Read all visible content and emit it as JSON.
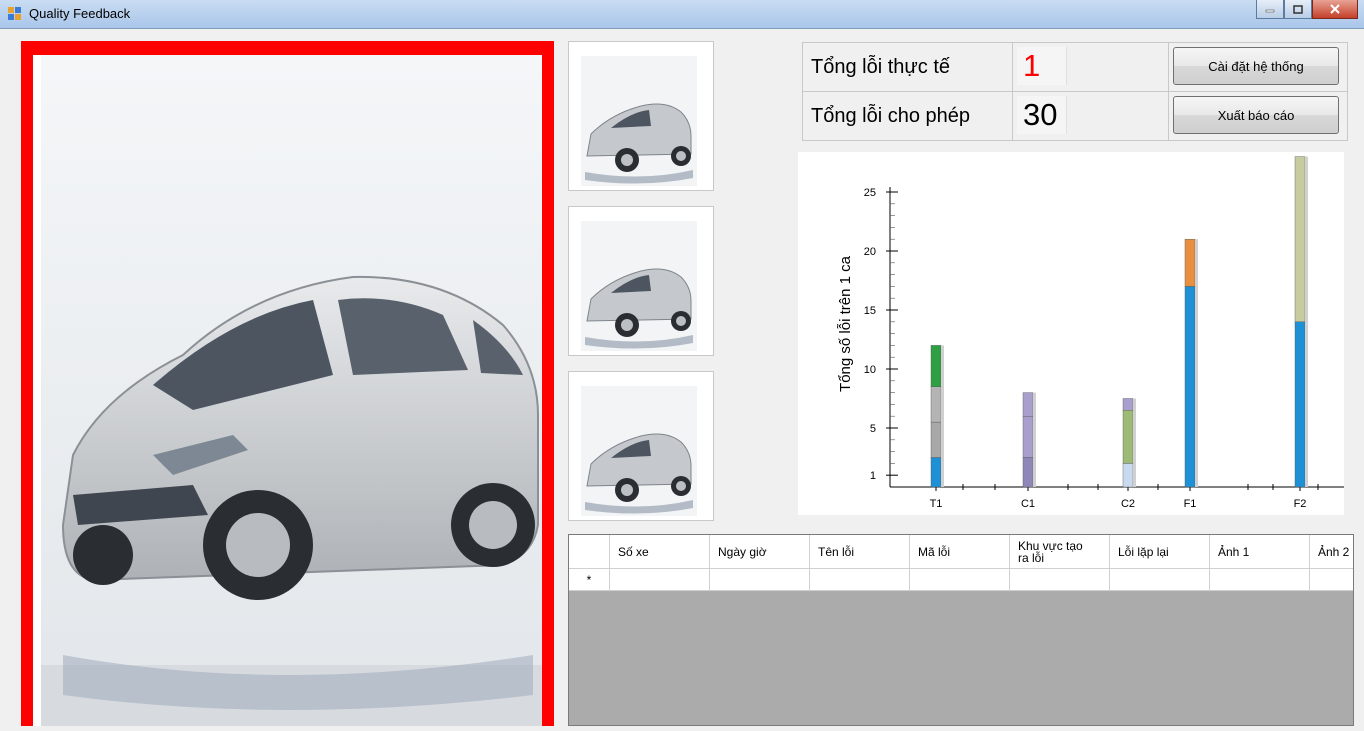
{
  "window": {
    "title": "Quality Feedback",
    "controls": {
      "minimize": "minimize-icon",
      "maximize": "maximize-icon",
      "close": "close-icon"
    }
  },
  "info": {
    "actual_label": "Tổng lỗi thực tế",
    "actual_value": "1",
    "allowed_label": "Tổng lỗi cho phép",
    "allowed_value": "30",
    "actual_value_color": "#ff0000"
  },
  "buttons": {
    "settings": "Cài đặt hệ thống",
    "export": "Xuất báo cáo"
  },
  "chart_data": {
    "type": "bar",
    "stacked": true,
    "ylabel": "Tổng số lỗi trên 1 ca",
    "categories": [
      "T1",
      "C1",
      "C2",
      "F1",
      "F2"
    ],
    "yticks": [
      1,
      5,
      10,
      15,
      20,
      25
    ],
    "ylim": [
      0,
      25
    ],
    "stacks": [
      {
        "category": "T1",
        "segments": [
          {
            "value": 2.5,
            "color": "#1e90d6"
          },
          {
            "value": 3,
            "color": "#a8a8a8"
          },
          {
            "value": 3,
            "color": "#b4b4b4"
          },
          {
            "value": 3.5,
            "color": "#2ea043"
          }
        ]
      },
      {
        "category": "C1",
        "segments": [
          {
            "value": 2.5,
            "color": "#8f87b8"
          },
          {
            "value": 3.5,
            "color": "#a99fcd"
          },
          {
            "value": 2,
            "color": "#a99fcd"
          }
        ]
      },
      {
        "category": "C2",
        "segments": [
          {
            "value": 2,
            "color": "#c9daf0"
          },
          {
            "value": 4.5,
            "color": "#9dbb77"
          },
          {
            "value": 1,
            "color": "#a99fcd"
          }
        ]
      },
      {
        "category": "F1",
        "segments": [
          {
            "value": 17,
            "color": "#1e90d6"
          },
          {
            "value": 4,
            "color": "#e89040"
          }
        ]
      },
      {
        "category": "F2",
        "segments": [
          {
            "value": 14,
            "color": "#1e90d6"
          },
          {
            "value": 14,
            "color": "#c7cca0"
          }
        ]
      }
    ]
  },
  "grid": {
    "columns": [
      "Số xe",
      "Ngày giờ",
      "Tên lỗi",
      "Mã lỗi",
      "Khu vực tạo ra lỗi",
      "Lỗi lặp lại",
      "Ảnh 1",
      "Ảnh 2"
    ],
    "new_row_marker": "*"
  },
  "images": {
    "main_photo": "car-photo",
    "thumbnails": [
      "car-thumbnail",
      "car-thumbnail",
      "car-thumbnail"
    ]
  }
}
